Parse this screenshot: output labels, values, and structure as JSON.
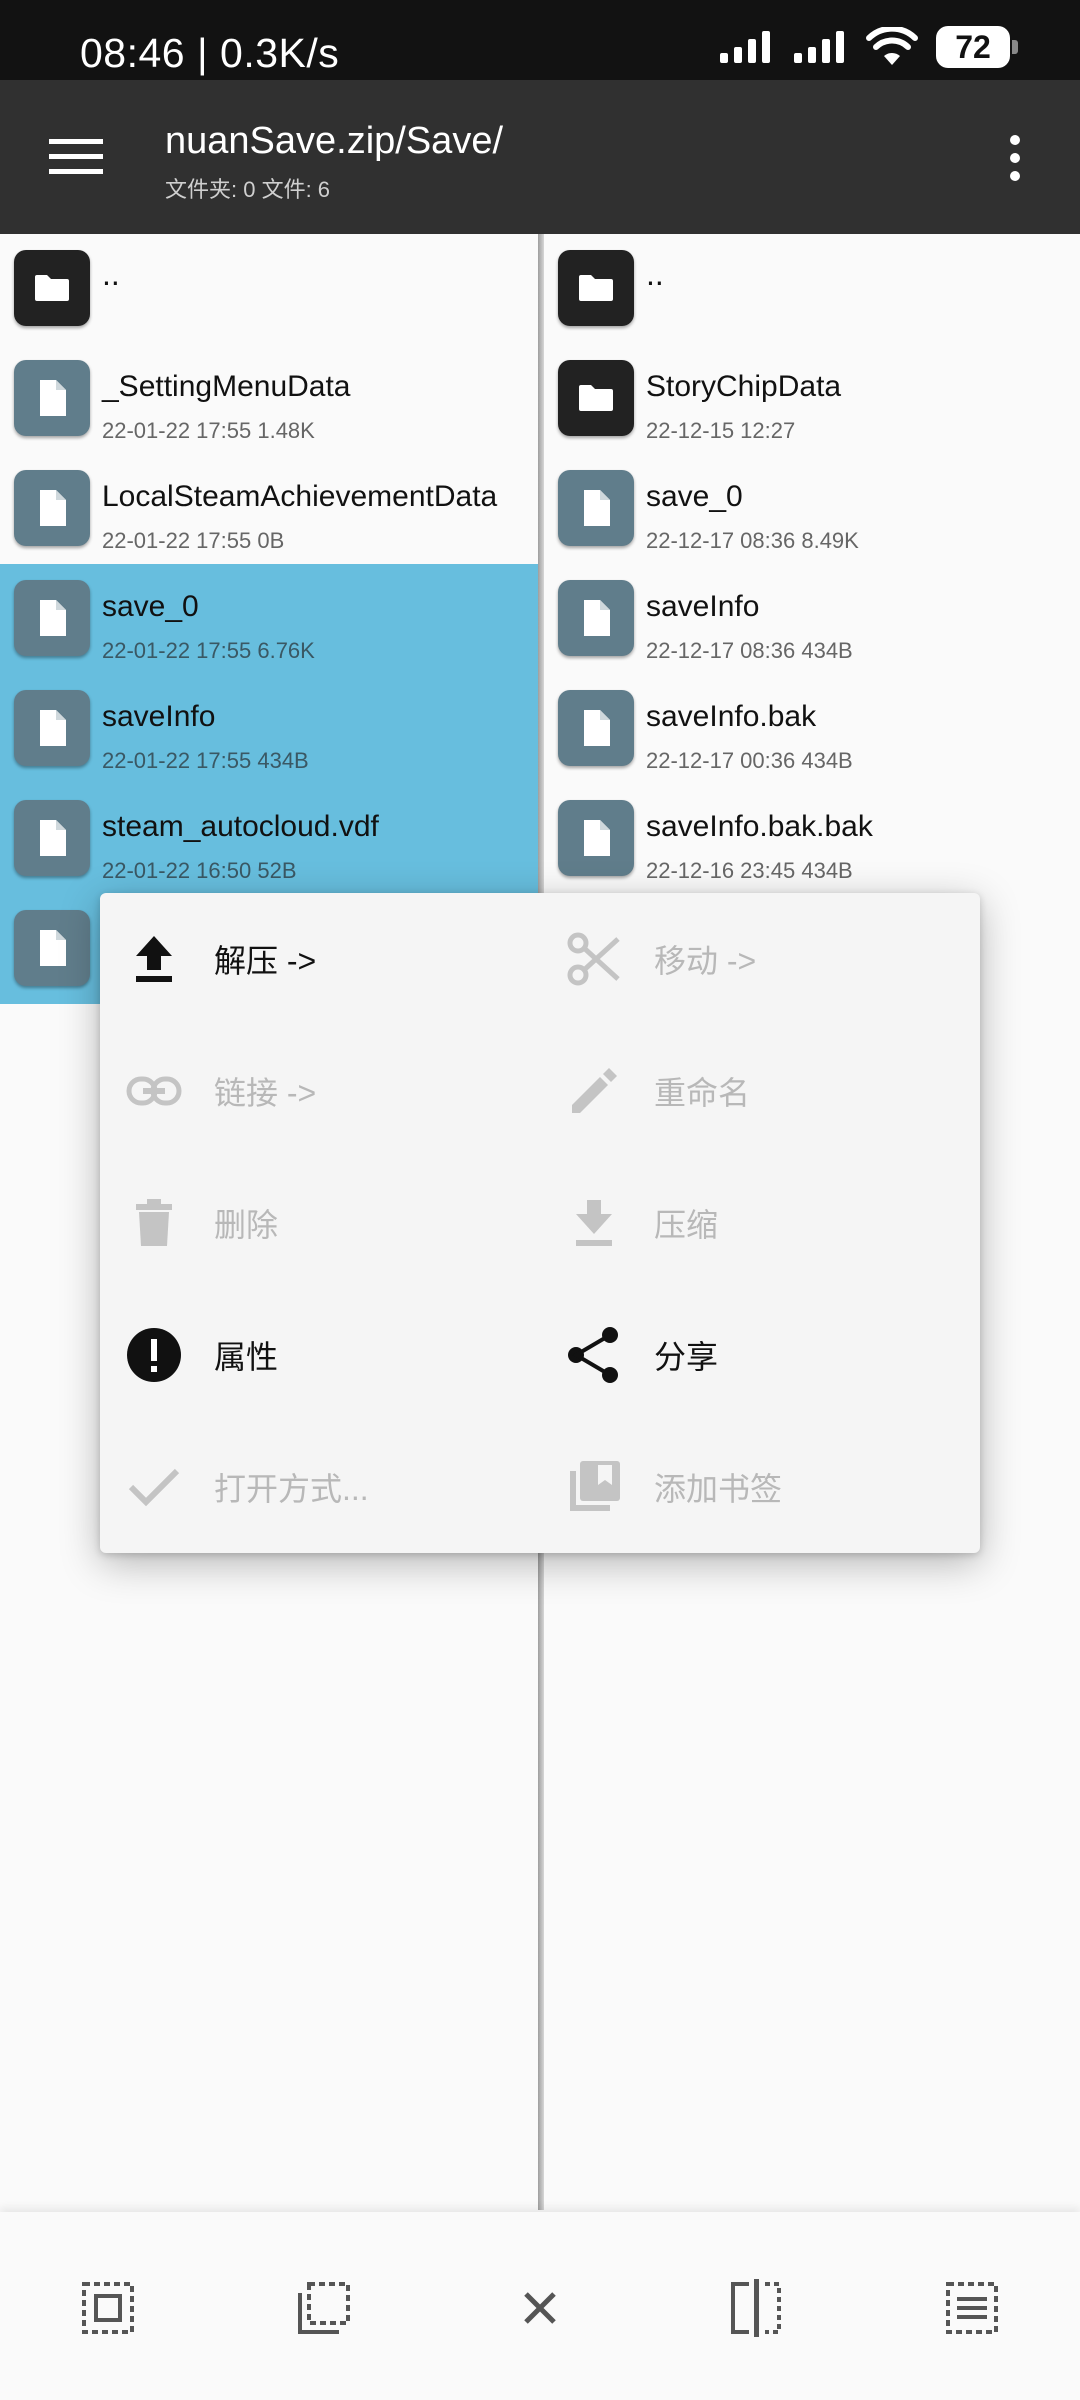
{
  "status": {
    "time": "08:46 | 0.3K/s",
    "battery": "72"
  },
  "toolbar": {
    "title": "nuanSave.zip/Save/",
    "subtitle": "文件夹: 0  文件: 6"
  },
  "left_pane": {
    "items": [
      {
        "name": "..",
        "meta": "",
        "type": "folder",
        "selected": false
      },
      {
        "name": "_SettingMenuData",
        "meta": "22-01-22 17:55  1.48K",
        "type": "file",
        "selected": false
      },
      {
        "name": "LocalSteamAchievementData",
        "meta": "22-01-22 17:55  0B",
        "type": "file",
        "selected": false
      },
      {
        "name": "save_0",
        "meta": "22-01-22 17:55  6.76K",
        "type": "file",
        "selected": true
      },
      {
        "name": "saveInfo",
        "meta": "22-01-22 17:55  434B",
        "type": "file",
        "selected": true
      },
      {
        "name": "steam_autocloud.vdf",
        "meta": "22-01-22 16:50  52B",
        "type": "file",
        "selected": true
      },
      {
        "name": "",
        "meta": "",
        "type": "file",
        "selected": true
      }
    ]
  },
  "right_pane": {
    "items": [
      {
        "name": "..",
        "meta": "",
        "type": "folder"
      },
      {
        "name": "StoryChipData",
        "meta": "22-12-15 12:27",
        "type": "folder"
      },
      {
        "name": "save_0",
        "meta": "22-12-17 08:36  8.49K",
        "type": "file"
      },
      {
        "name": "saveInfo",
        "meta": "22-12-17 08:36  434B",
        "type": "file"
      },
      {
        "name": "saveInfo.bak",
        "meta": "22-12-17 00:36  434B",
        "type": "file"
      },
      {
        "name": "saveInfo.bak.bak",
        "meta": "22-12-16 23:45  434B",
        "type": "file"
      }
    ]
  },
  "menu": {
    "items": [
      {
        "label": "解压 ->",
        "icon": "upload-icon",
        "enabled": true
      },
      {
        "label": "移动 ->",
        "icon": "scissors-icon",
        "enabled": false
      },
      {
        "label": "链接 ->",
        "icon": "link-icon",
        "enabled": false
      },
      {
        "label": "重命名",
        "icon": "pencil-icon",
        "enabled": false
      },
      {
        "label": "删除",
        "icon": "trash-icon",
        "enabled": false
      },
      {
        "label": "压缩",
        "icon": "download-icon",
        "enabled": false
      },
      {
        "label": "属性",
        "icon": "info-exclamation-icon",
        "enabled": true
      },
      {
        "label": "分享",
        "icon": "share-icon",
        "enabled": true
      },
      {
        "label": "打开方式...",
        "icon": "check-icon",
        "enabled": false
      },
      {
        "label": "添加书签",
        "icon": "bookmark-library-icon",
        "enabled": false
      }
    ]
  },
  "bottom_bar": {
    "icons": [
      "select-all-icon",
      "select-inverse-icon",
      "close-icon",
      "compare-split-icon",
      "select-list-icon"
    ]
  },
  "colors": {
    "selected_row": "#67bede",
    "toolbar": "#303030",
    "file_icon": "#607d8b",
    "folder_icon": "#222222"
  }
}
